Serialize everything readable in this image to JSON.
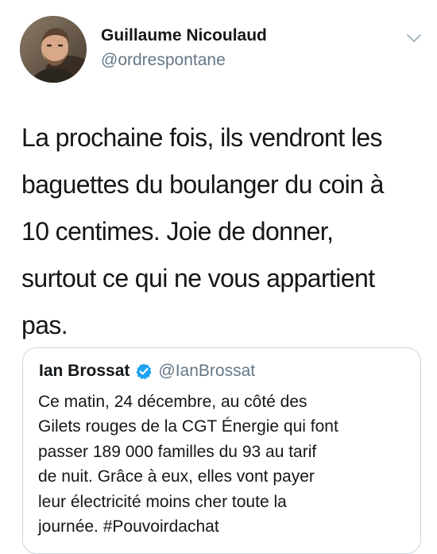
{
  "tweet": {
    "author": {
      "display_name": "Guillaume Nicoulaud",
      "handle": "@ordrespontane",
      "avatar_icon": "profile-photo"
    },
    "menu_icon": "chevron-down-icon",
    "text": "La prochaine fois, ils vendront les\nbaguettes du boulanger du coin à\n10 centimes. Joie de donner,\nsurtout ce qui ne vous appartient\npas.",
    "quoted_tweet": {
      "display_name": "Ian Brossat",
      "verified_icon": "verified-badge-icon",
      "handle": "@IanBrossat",
      "text": "Ce matin, 24 décembre, au côté des\nGilets rouges de la CGT Énergie qui font\npasser 189 000 familles du 93 au tarif\nde nuit. Grâce à eux, elles vont payer\nleur électricité moins cher toute la\njournée. #Pouvoirdachat"
    }
  },
  "colors": {
    "primary_text": "#14171a",
    "secondary_text": "#657786",
    "verified_blue": "#1da1f2",
    "border": "#ccd6dd"
  }
}
